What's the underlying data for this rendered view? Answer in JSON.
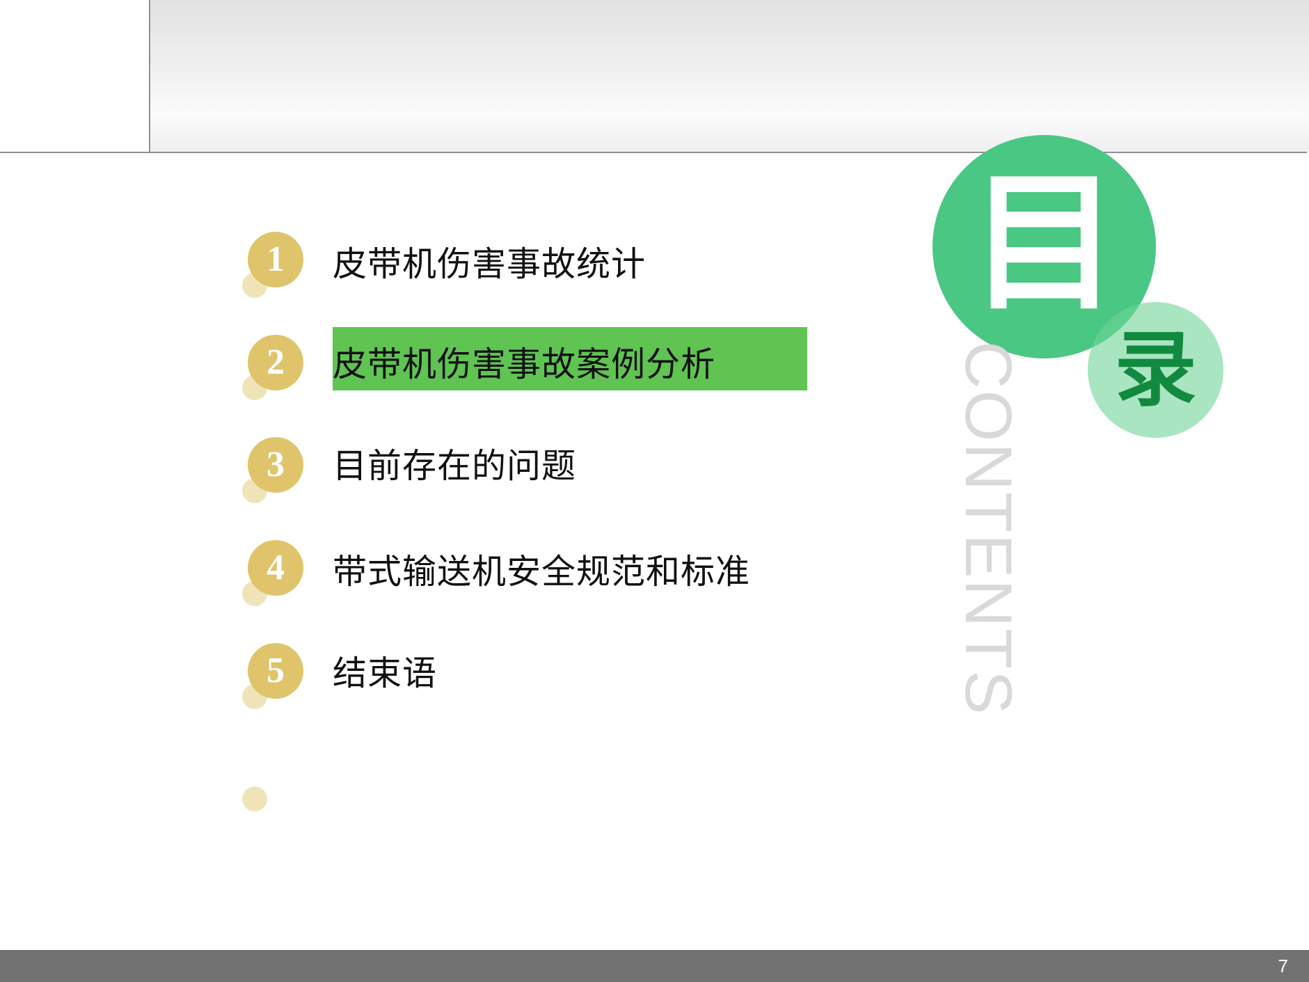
{
  "badge": {
    "main_char": "目",
    "sub_char": "录",
    "english": "CONTENTS"
  },
  "items": [
    {
      "number": "1",
      "label": "皮带机伤害事故统计",
      "highlighted": false
    },
    {
      "number": "2",
      "label": "皮带机伤害事故案例分析",
      "highlighted": true
    },
    {
      "number": "3",
      "label": "目前存在的问题",
      "highlighted": false
    },
    {
      "number": "4",
      "label": "带式输送机安全规范和标准",
      "highlighted": false
    },
    {
      "number": "5",
      "label": "结束语",
      "highlighted": false
    }
  ],
  "footer": {
    "page_number": "7"
  },
  "colors": {
    "number_bullet": "#dfc46b",
    "bullet_shadow": "#efe4b8",
    "highlight": "#5fc452",
    "badge_main": "#49c783",
    "badge_sub": "#8edfb0",
    "badge_sub_text": "#118a3f",
    "footer": "#727272"
  }
}
